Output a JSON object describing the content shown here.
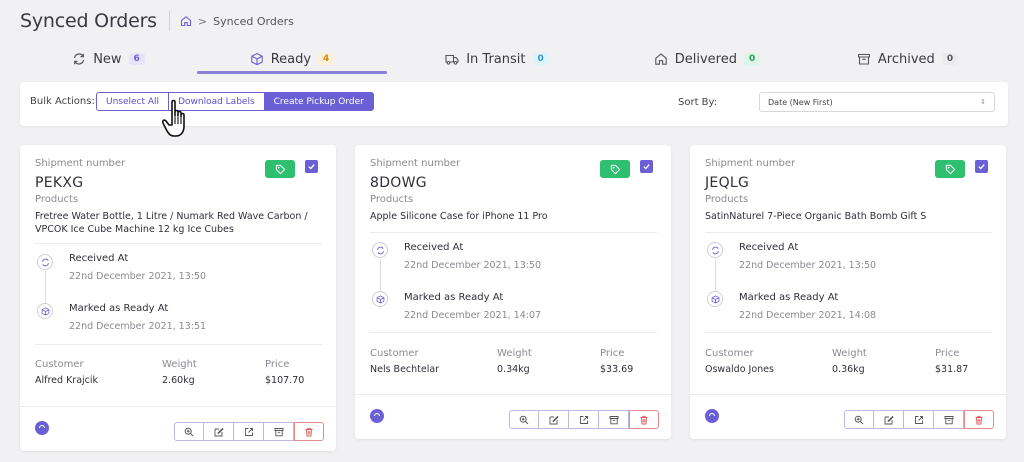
{
  "header": {
    "title": "Synced Orders",
    "breadcrumb": {
      "current": "Synced Orders",
      "separator": ">"
    }
  },
  "tabs": [
    {
      "label": "New",
      "count": "6",
      "icon": "refresh-icon",
      "badge_bg": "#e6e3fb",
      "badge_fg": "#6b5fd6"
    },
    {
      "label": "Ready",
      "count": "4",
      "icon": "box-icon",
      "badge_bg": "#fdf0d6",
      "badge_fg": "#d08a1a",
      "active": true
    },
    {
      "label": "In Transit",
      "count": "0",
      "icon": "truck-icon",
      "badge_bg": "#dff3fa",
      "badge_fg": "#2b9cc4"
    },
    {
      "label": "Delivered",
      "count": "0",
      "icon": "home-icon",
      "badge_bg": "#dcf5e6",
      "badge_fg": "#2a9a5c"
    },
    {
      "label": "Archived",
      "count": "0",
      "icon": "archive-icon",
      "badge_bg": "#ececef",
      "badge_fg": "#555555"
    }
  ],
  "toolbar": {
    "bulk_label": "Bulk Actions:",
    "unselect_all": "Unselect All",
    "download_labels": "Download Labels",
    "create_pickup": "Create Pickup Order",
    "sort_label": "Sort By:",
    "sort_value": "Date (New First)"
  },
  "labels": {
    "shipment_number": "Shipment number",
    "products": "Products",
    "received_at": "Received At",
    "marked_ready": "Marked as Ready At",
    "customer": "Customer",
    "weight": "Weight",
    "price": "Price"
  },
  "cards": [
    {
      "shipment": "PEKXG",
      "products": "Fretree Water Bottle, 1 Litre / Numark Red Wave Carbon / VPCOK Ice Cube Machine 12 kg Ice Cubes",
      "received": "22nd December 2021, 13:50",
      "ready": "22nd December 2021, 13:51",
      "customer": "Alfred Krajcik",
      "weight": "2.60kg",
      "price": "$107.70"
    },
    {
      "shipment": "8DOWG",
      "products": "Apple Silicone Case for iPhone 11 Pro",
      "received": "22nd December 2021, 13:50",
      "ready": "22nd December 2021, 14:07",
      "customer": "Nels Bechtelar",
      "weight": "0.34kg",
      "price": "$33.69"
    },
    {
      "shipment": "JEQLG",
      "products": "SatinNaturel 7-Piece Organic Bath Bomb Gift S",
      "received": "22nd December 2021, 13:50",
      "ready": "22nd December 2021, 14:08",
      "customer": "Oswaldo Jones",
      "weight": "0.36kg",
      "price": "$31.87"
    }
  ],
  "colors": {
    "accent": "#6b5fd6",
    "tag": "#2fbf71",
    "danger": "#e05555"
  }
}
